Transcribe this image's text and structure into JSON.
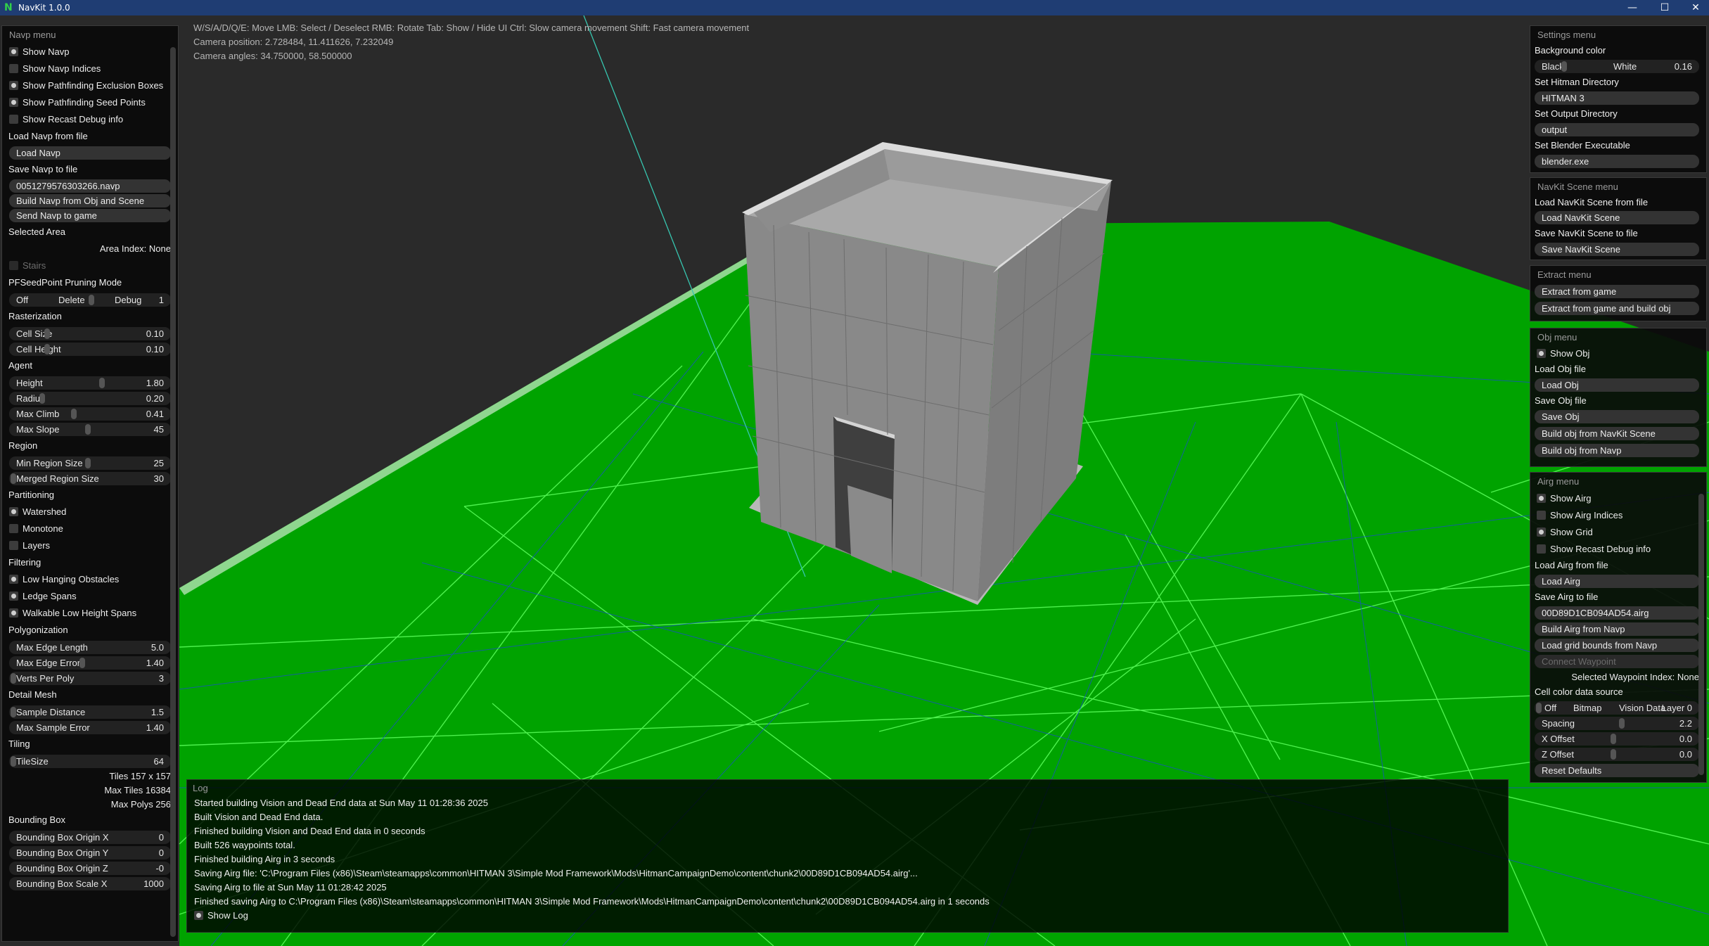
{
  "window": {
    "title": "NavKit 1.0.0",
    "logo_glyph": "N",
    "minimize_glyph": "—",
    "maximize_glyph": "☐",
    "close_glyph": "✕"
  },
  "hud": {
    "controls": "W/S/A/D/Q/E: Move  LMB: Select / Deselect RMB: Rotate  Tab: Show / Hide UI  Ctrl: Slow camera movement  Shift: Fast camera movement",
    "camera_position": "Camera position: 2.728484, 11.411626, 7.232049",
    "camera_angles": "Camera angles: 34.750000, 58.500000"
  },
  "navp_menu": {
    "title": "Navp menu",
    "checks": [
      {
        "label": "Show Navp",
        "on": true
      },
      {
        "label": "Show Navp Indices",
        "on": false
      },
      {
        "label": "Show Pathfinding Exclusion Boxes",
        "on": true
      },
      {
        "label": "Show Pathfinding Seed Points",
        "on": true
      },
      {
        "label": "Show Recast Debug info",
        "on": false
      }
    ],
    "load_label": "Load Navp from file",
    "load_button": "Load Navp",
    "save_label": "Save Navp to file",
    "save_file": "0051279576303266.navp",
    "build_button": "Build Navp from Obj and Scene",
    "send_button": "Send Navp to game",
    "selected_area": "Selected Area",
    "area_index": "Area Index: None",
    "stairs": "Stairs",
    "pruning_mode": "PFSeedPoint Pruning Mode",
    "pruning_off": "Off",
    "pruning_delete": "Delete",
    "pruning_debug": "Debug",
    "pruning_value": "1",
    "rasterization": "Rasterization",
    "cell_size": {
      "label": "Cell Size",
      "value": "0.10"
    },
    "cell_height": {
      "label": "Cell Height",
      "value": "0.10"
    },
    "agent": "Agent",
    "height": {
      "label": "Height",
      "value": "1.80"
    },
    "radius": {
      "label": "Radius",
      "value": "0.20"
    },
    "max_climb": {
      "label": "Max Climb",
      "value": "0.41"
    },
    "max_slope": {
      "label": "Max Slope",
      "value": "45"
    },
    "region": "Region",
    "min_region": {
      "label": "Min Region Size",
      "value": "25"
    },
    "merged_region": {
      "label": "Merged Region Size",
      "value": "30"
    },
    "partitioning": "Partitioning",
    "watershed": "Watershed",
    "monotone": "Monotone",
    "layers": "Layers",
    "filtering": "Filtering",
    "low_hanging": "Low Hanging Obstacles",
    "ledge_spans": "Ledge Spans",
    "walkable_low": "Walkable Low Height Spans",
    "polygonization": "Polygonization",
    "max_edge_length": {
      "label": "Max Edge Length",
      "value": "5.0"
    },
    "max_edge_error": {
      "label": "Max Edge Error",
      "value": "1.40"
    },
    "verts_per_poly": {
      "label": "Verts Per Poly",
      "value": "3"
    },
    "detail_mesh": "Detail Mesh",
    "sample_distance": {
      "label": "Sample Distance",
      "value": "1.5"
    },
    "max_sample_error": {
      "label": "Max Sample Error",
      "value": "1.40"
    },
    "tiling": "Tiling",
    "tile_size": {
      "label": "TileSize",
      "value": "64"
    },
    "tiles": "Tiles  157 x 157",
    "max_tiles": "Max Tiles  16384",
    "max_polys": "Max Polys  256",
    "bounding_box": "Bounding Box",
    "bb_origin_x": {
      "label": "Bounding Box Origin X",
      "value": "0"
    },
    "bb_origin_y": {
      "label": "Bounding Box Origin Y",
      "value": "0"
    },
    "bb_origin_z": {
      "label": "Bounding Box Origin Z",
      "value": "-0"
    },
    "bb_scale_x": {
      "label": "Bounding Box Scale X",
      "value": "1000"
    }
  },
  "settings_menu": {
    "title": "Settings menu",
    "bg_label": "Background color",
    "bg_black": "Black",
    "bg_white": "White",
    "bg_value": "0.16",
    "hitman_dir_label": "Set Hitman Directory",
    "hitman_dir": "HITMAN 3",
    "output_dir_label": "Set Output Directory",
    "output_dir": "output",
    "blender_label": "Set Blender Executable",
    "blender": "blender.exe"
  },
  "scene_menu": {
    "title": "NavKit Scene menu",
    "load_label": "Load NavKit Scene from file",
    "load_button": "Load NavKit Scene",
    "save_label": "Save NavKit Scene to file",
    "save_button": "Save NavKit Scene"
  },
  "extract_menu": {
    "title": "Extract menu",
    "extract_button": "Extract from game",
    "extract_build_button": "Extract from game and build obj"
  },
  "obj_menu": {
    "title": "Obj menu",
    "show_obj": "Show Obj",
    "load_label": "Load Obj file",
    "load_button": "Load Obj",
    "save_label": "Save Obj file",
    "save_button": "Save Obj",
    "build_scene_button": "Build obj from NavKit Scene",
    "build_navp_button": "Build obj from Navp"
  },
  "airg_menu": {
    "title": "Airg menu",
    "show_airg": "Show Airg",
    "show_indices": "Show Airg Indices",
    "show_grid": "Show Grid",
    "show_recast": "Show Recast Debug info",
    "load_label": "Load Airg from file",
    "load_button": "Load Airg",
    "save_label": "Save Airg to file",
    "save_file": "00D89D1CB094AD54.airg",
    "build_button": "Build Airg from Navp",
    "grid_bounds_button": "Load grid bounds from Navp",
    "connect_button": "Connect Waypoint",
    "selected_waypoint": "Selected Waypoint Index: None",
    "cell_color_label": "Cell color data source",
    "cc_off": "Off",
    "cc_bitmap": "Bitmap",
    "cc_vision": "Vision Data",
    "cc_layer": "Layer  0",
    "spacing": {
      "label": "Spacing",
      "value": "2.2"
    },
    "x_offset": {
      "label": "X Offset",
      "value": "0.0"
    },
    "z_offset": {
      "label": "Z Offset",
      "value": "0.0"
    },
    "reset_button": "Reset Defaults"
  },
  "log": {
    "title": "Log",
    "lines": [
      "Started building Vision and Dead End data at Sun May 11 01:28:36 2025",
      "Built Vision and Dead End data.",
      "Finished building Vision and Dead End data in 0 seconds",
      "Built 526 waypoints total.",
      "Finished building Airg in 3 seconds",
      "Saving Airg file: 'C:\\Program Files (x86)\\Steam\\steamapps\\common\\HITMAN 3\\Simple Mod Framework\\Mods\\HitmanCampaignDemo\\content\\chunk2\\00D89D1CB094AD54.airg'...",
      "Saving Airg to file at Sun May 11 01:28:42 2025",
      "Finished saving Airg to C:\\Program Files (x86)\\Steam\\steamapps\\common\\HITMAN 3\\Simple Mod Framework\\Mods\\HitmanCampaignDemo\\content\\chunk2\\00D89D1CB094AD54.airg in 1 seconds"
    ],
    "show_log": "Show Log"
  },
  "colors": {
    "ground": "#00a300",
    "grid_line": "#5cff5c",
    "nav_line": "#1a4bd0",
    "titlebar": "#1f3d73"
  }
}
